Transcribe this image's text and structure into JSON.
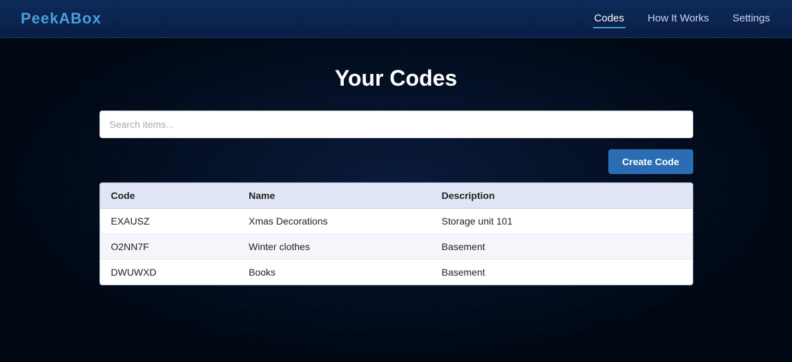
{
  "nav": {
    "logo": "PeekABox",
    "links": [
      {
        "id": "codes",
        "label": "Codes",
        "active": true
      },
      {
        "id": "how-it-works",
        "label": "How It Works",
        "active": false
      },
      {
        "id": "settings",
        "label": "Settings",
        "active": false
      }
    ]
  },
  "main": {
    "page_title": "Your Codes",
    "search_placeholder": "Search items...",
    "create_button_label": "Create Code"
  },
  "table": {
    "columns": [
      {
        "id": "code",
        "label": "Code"
      },
      {
        "id": "name",
        "label": "Name"
      },
      {
        "id": "description",
        "label": "Description"
      }
    ],
    "rows": [
      {
        "code": "EXAUSZ",
        "name": "Xmas Decorations",
        "description": "Storage unit 101"
      },
      {
        "code": "O2NN7F",
        "name": "Winter clothes",
        "description": "Basement"
      },
      {
        "code": "DWUWXD",
        "name": "Books",
        "description": "Basement"
      }
    ]
  }
}
